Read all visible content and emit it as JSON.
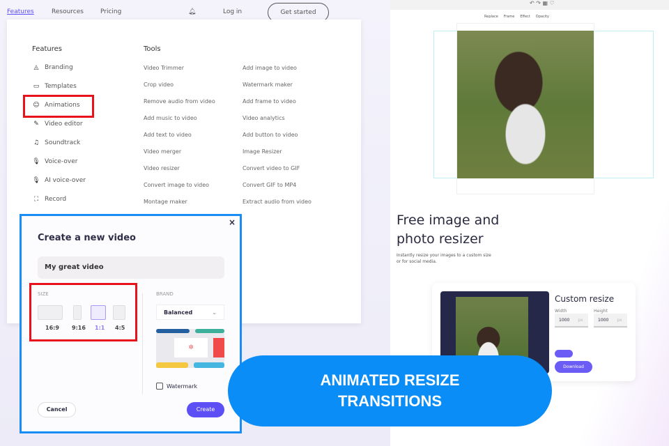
{
  "nav": {
    "features": "Features",
    "resources": "Resources",
    "pricing": "Pricing",
    "login": "Log in",
    "get_started": "Get started"
  },
  "menu": {
    "features_heading": "Features",
    "tools_heading": "Tools",
    "features": [
      {
        "label": "Branding",
        "icon": "palette-icon"
      },
      {
        "label": "Templates",
        "icon": "template-icon"
      },
      {
        "label": "Animations",
        "icon": "smile-icon"
      },
      {
        "label": "Video editor",
        "icon": "pencil-icon"
      },
      {
        "label": "Soundtrack",
        "icon": "music-icon"
      },
      {
        "label": "Voice-over",
        "icon": "mic-icon"
      },
      {
        "label": "AI voice-over",
        "icon": "ai-mic-icon"
      },
      {
        "label": "Record",
        "icon": "record-icon"
      }
    ],
    "tools_col1": [
      "Video Trimmer",
      "Crop video",
      "Remove audio from video",
      "Add music to video",
      "Add text to video",
      "Video merger",
      "Video resizer",
      "Convert image to video",
      "Montage maker"
    ],
    "tools_col2": [
      "Add image to video",
      "Watermark maker",
      "Add frame to video",
      "Video analytics",
      "Add button to video",
      "Image Resizer",
      "Convert video to GIF",
      "Convert GIF to MP4",
      "Extract audio from video"
    ]
  },
  "dialog": {
    "title": "Create a new video",
    "name_value": "My great video",
    "size_label": "SIZE",
    "sizes": [
      "16:9",
      "9:16",
      "1:1",
      "4:5"
    ],
    "selected_size": "1:1",
    "brand_label": "BRAND",
    "brand_value": "Balanced",
    "watermark": "Watermark",
    "cancel": "Cancel",
    "create": "Create",
    "accent": "#5b4ff5"
  },
  "editor": {
    "toolbar": [
      "Replace",
      "Frame",
      "Effect",
      "Opacity"
    ]
  },
  "resizer": {
    "title_line1": "Free image and",
    "title_line2": "photo resizer",
    "subtitle_line1": "Instantly resize your images to a custom size",
    "subtitle_line2": "or for social media.",
    "card_title": "Custom resize",
    "width_label": "Width",
    "height_label": "Height",
    "width_value": "1000",
    "height_value": "1000",
    "unit": "px",
    "download": "Download"
  },
  "banner": {
    "line1": "ANIMATED RESIZE",
    "line2": "TRANSITIONS",
    "color": "#0a8df7"
  }
}
